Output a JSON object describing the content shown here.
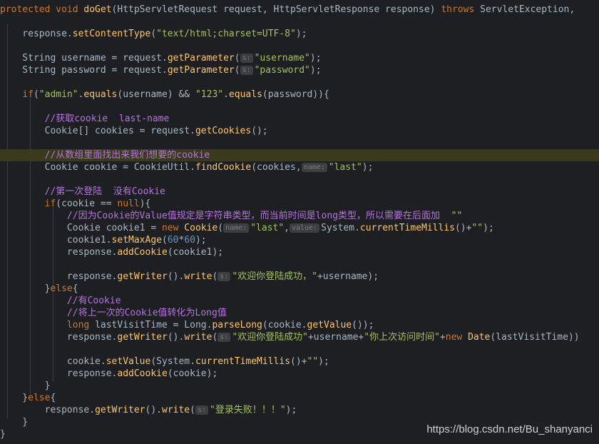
{
  "editor": {
    "lines": [
      "protected void doGet(HttpServletRequest request, HttpServletResponse response) throws ServletException,",
      "",
      "    response.setContentType(\"text/html;charset=UTF-8\");",
      "",
      "    String username = request.getParameter(\"username\");",
      "    String password = request.getParameter(\"password\");",
      "",
      "    if(\"admin\".equals(username) && \"123\".equals(password)){",
      "",
      "        //获取cookie  last-name",
      "        Cookie[] cookies = request.getCookies();",
      "",
      "        //从数组里面找出来我们想要的cookie",
      "        Cookie cookie = CookieUtil.findCookie(cookies, \"last\");",
      "",
      "        //第一次登陆  没有Cookie",
      "        if(cookie == null){",
      "            //因为Cookie的Value值规定是字符串类型，而当前时间是long类型，所以需要在后面加  \"\"",
      "            Cookie cookie1 = new Cookie(\"last\", System.currentTimeMillis()+\"\");",
      "            cookie1.setMaxAge(60*60);",
      "            response.addCookie(cookie1);",
      "",
      "            response.getWriter().write(\"欢迎你登陆成功，\"+username);",
      "        }else{",
      "            //有Cookie",
      "            //将上一次的Cookie值转化为Long值",
      "            long lastVisitTime = Long.parseLong(cookie.getValue());",
      "            response.getWriter().write(\"欢迎你登陆成功\"+username+\"你上次访问时间\"+new Date(lastVisitTime))",
      "",
      "            cookie.setValue(System.currentTimeMillis()+\"\");",
      "            response.addCookie(cookie);",
      "        }",
      "    }else{",
      "        response.getWriter().write(\"登录失败！！！\");",
      "    }",
      "}"
    ],
    "param_hints": [
      "s:",
      "s:",
      "name:",
      "name:",
      "value:",
      "s:",
      "s:",
      "s:"
    ],
    "highlighted_line": 13
  },
  "watermark": "https://blog.csdn.net/Bu_shanyanci",
  "colors": {
    "background": "#1e1f22",
    "keyword": "#cc7832",
    "method": "#ffc66d",
    "string": "#a5c25c",
    "number": "#6897bb",
    "comment": "#b574e0",
    "text": "#a9b7c6"
  }
}
